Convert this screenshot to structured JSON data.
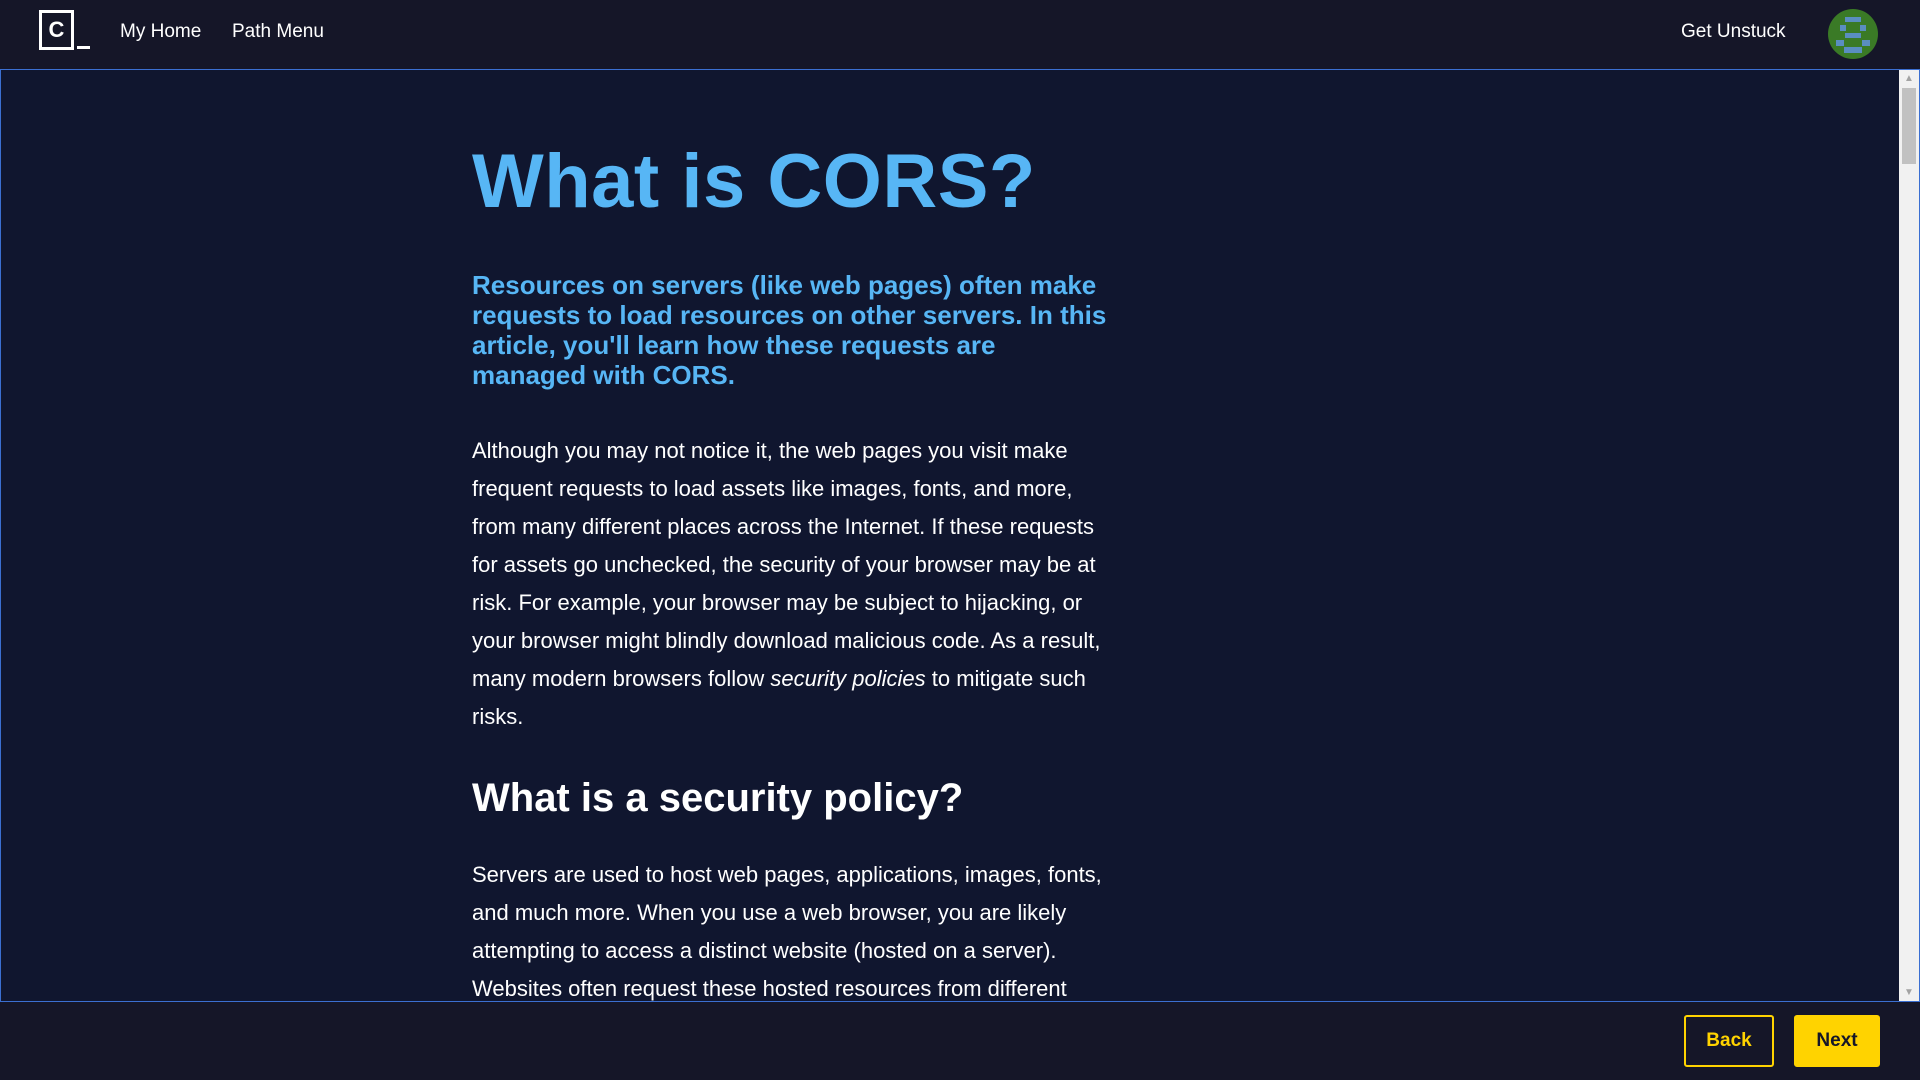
{
  "header": {
    "logo_letter": "C",
    "nav": {
      "home": "My Home",
      "path_menu": "Path Menu"
    },
    "get_unstuck": "Get Unstuck"
  },
  "article": {
    "title": "What is CORS?",
    "lede": "Resources on servers (like web pages) often make requests to load resources on other servers. In this article, you'll learn how these requests are managed with CORS.",
    "para1_before": "Although you may not notice it, the web pages you visit make frequent requests to load assets like images, fonts, and more, from many different places across the Internet. If these requests for assets go unchecked, the security of your browser may be at risk. For example, your browser may be subject to hijacking, or your browser might blindly download malicious code. As a result, many modern browsers follow ",
    "para1_em": "security policies",
    "para1_after": " to mitigate such risks.",
    "heading2": "What is a security policy?",
    "para2": "Servers are used to host web pages, applications, images, fonts, and much more. When you use a web browser, you are likely attempting to access a distinct website (hosted on a server). Websites often request these hosted resources from different"
  },
  "footer": {
    "back": "Back",
    "next": "Next"
  },
  "colors": {
    "accent_blue": "#57b6f5",
    "accent_yellow": "#ffd300",
    "background": "#10162f",
    "bar": "#151628"
  },
  "icons": {
    "logo": "codecademy-logo-icon",
    "avatar": "pixel-avatar-icon"
  }
}
